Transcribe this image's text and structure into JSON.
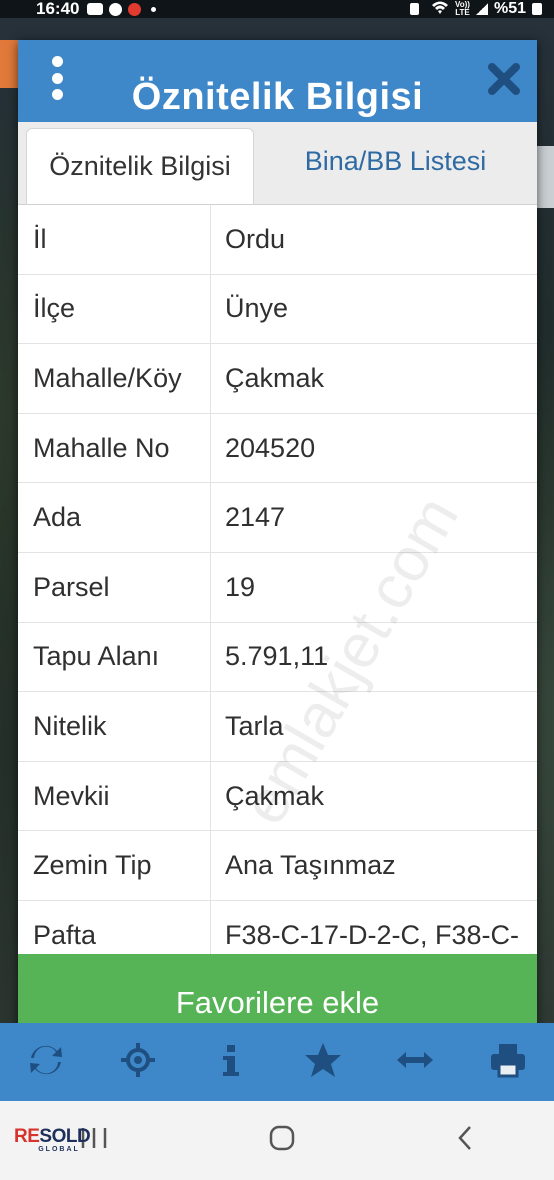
{
  "status_bar": {
    "time": "16:40",
    "network_top": "Vo))",
    "network_bottom": "LTE",
    "battery": "%51"
  },
  "dialog": {
    "title": "Öznitelik Bilgisi",
    "tabs": [
      {
        "label": "Öznitelik Bilgisi",
        "active": true
      },
      {
        "label": "Bina/BB Listesi",
        "active": false
      }
    ],
    "rows": [
      {
        "key": "İl",
        "value": "Ordu"
      },
      {
        "key": "İlçe",
        "value": "Ünye"
      },
      {
        "key": "Mahalle/Köy",
        "value": "Çakmak"
      },
      {
        "key": "Mahalle No",
        "value": "204520"
      },
      {
        "key": "Ada",
        "value": "2147"
      },
      {
        "key": "Parsel",
        "value": "19"
      },
      {
        "key": "Tapu Alanı",
        "value": "5.791,11"
      },
      {
        "key": "Nitelik",
        "value": "Tarla"
      },
      {
        "key": "Mevkii",
        "value": "Çakmak"
      },
      {
        "key": "Zemin Tip",
        "value": "Ana Taşınmaz"
      },
      {
        "key": "Pafta",
        "value": "F38-C-17-D-2-C, F38-C-"
      }
    ],
    "favorite_button": "Favorilere ekle",
    "watermark": "emlakjet.com"
  },
  "toolbar": {
    "icons": [
      "refresh-icon",
      "locate-icon",
      "info-icon",
      "star-icon",
      "measure-icon",
      "print-icon"
    ]
  },
  "logo": {
    "re": "RE",
    "sold": "SOLD",
    "global": "GLOBAL"
  },
  "colors": {
    "header_blue": "#3e87c8",
    "tab_link_blue": "#2f6aa3",
    "favorite_green": "#56b356",
    "logo_red": "#d6332c",
    "logo_navy": "#1d2f5b"
  }
}
